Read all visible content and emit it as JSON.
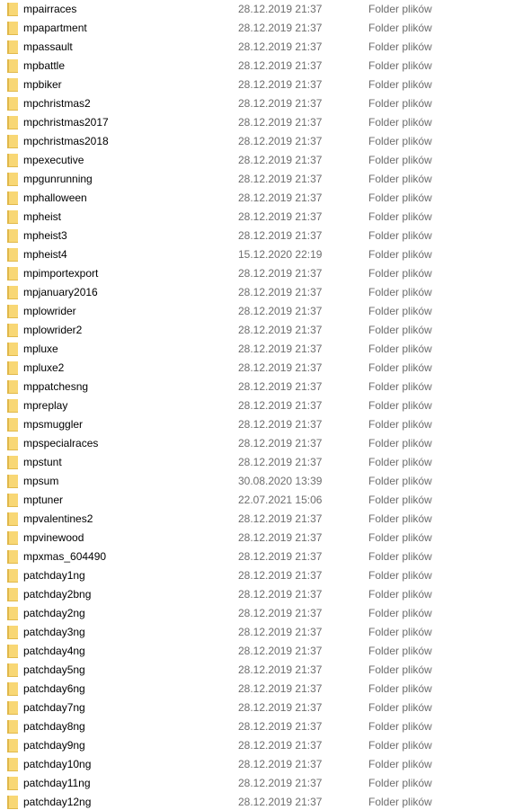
{
  "icon": "folder-icon",
  "colors": {
    "folder_body": "#f8d775",
    "folder_edge": "#e0b84a",
    "secondary_text": "#6d6d6d"
  },
  "rows": [
    {
      "name": "mpairraces",
      "date": "28.12.2019 21:37",
      "type": "Folder plików"
    },
    {
      "name": "mpapartment",
      "date": "28.12.2019 21:37",
      "type": "Folder plików"
    },
    {
      "name": "mpassault",
      "date": "28.12.2019 21:37",
      "type": "Folder plików"
    },
    {
      "name": "mpbattle",
      "date": "28.12.2019 21:37",
      "type": "Folder plików"
    },
    {
      "name": "mpbiker",
      "date": "28.12.2019 21:37",
      "type": "Folder plików"
    },
    {
      "name": "mpchristmas2",
      "date": "28.12.2019 21:37",
      "type": "Folder plików"
    },
    {
      "name": "mpchristmas2017",
      "date": "28.12.2019 21:37",
      "type": "Folder plików"
    },
    {
      "name": "mpchristmas2018",
      "date": "28.12.2019 21:37",
      "type": "Folder plików"
    },
    {
      "name": "mpexecutive",
      "date": "28.12.2019 21:37",
      "type": "Folder plików"
    },
    {
      "name": "mpgunrunning",
      "date": "28.12.2019 21:37",
      "type": "Folder plików"
    },
    {
      "name": "mphalloween",
      "date": "28.12.2019 21:37",
      "type": "Folder plików"
    },
    {
      "name": "mpheist",
      "date": "28.12.2019 21:37",
      "type": "Folder plików"
    },
    {
      "name": "mpheist3",
      "date": "28.12.2019 21:37",
      "type": "Folder plików"
    },
    {
      "name": "mpheist4",
      "date": "15.12.2020 22:19",
      "type": "Folder plików"
    },
    {
      "name": "mpimportexport",
      "date": "28.12.2019 21:37",
      "type": "Folder plików"
    },
    {
      "name": "mpjanuary2016",
      "date": "28.12.2019 21:37",
      "type": "Folder plików"
    },
    {
      "name": "mplowrider",
      "date": "28.12.2019 21:37",
      "type": "Folder plików"
    },
    {
      "name": "mplowrider2",
      "date": "28.12.2019 21:37",
      "type": "Folder plików"
    },
    {
      "name": "mpluxe",
      "date": "28.12.2019 21:37",
      "type": "Folder plików"
    },
    {
      "name": "mpluxe2",
      "date": "28.12.2019 21:37",
      "type": "Folder plików"
    },
    {
      "name": "mppatchesng",
      "date": "28.12.2019 21:37",
      "type": "Folder plików"
    },
    {
      "name": "mpreplay",
      "date": "28.12.2019 21:37",
      "type": "Folder plików"
    },
    {
      "name": "mpsmuggler",
      "date": "28.12.2019 21:37",
      "type": "Folder plików"
    },
    {
      "name": "mpspecialraces",
      "date": "28.12.2019 21:37",
      "type": "Folder plików"
    },
    {
      "name": "mpstunt",
      "date": "28.12.2019 21:37",
      "type": "Folder plików"
    },
    {
      "name": "mpsum",
      "date": "30.08.2020 13:39",
      "type": "Folder plików"
    },
    {
      "name": "mptuner",
      "date": "22.07.2021 15:06",
      "type": "Folder plików"
    },
    {
      "name": "mpvalentines2",
      "date": "28.12.2019 21:37",
      "type": "Folder plików"
    },
    {
      "name": "mpvinewood",
      "date": "28.12.2019 21:37",
      "type": "Folder plików"
    },
    {
      "name": "mpxmas_604490",
      "date": "28.12.2019 21:37",
      "type": "Folder plików"
    },
    {
      "name": "patchday1ng",
      "date": "28.12.2019 21:37",
      "type": "Folder plików"
    },
    {
      "name": "patchday2bng",
      "date": "28.12.2019 21:37",
      "type": "Folder plików"
    },
    {
      "name": "patchday2ng",
      "date": "28.12.2019 21:37",
      "type": "Folder plików"
    },
    {
      "name": "patchday3ng",
      "date": "28.12.2019 21:37",
      "type": "Folder plików"
    },
    {
      "name": "patchday4ng",
      "date": "28.12.2019 21:37",
      "type": "Folder plików"
    },
    {
      "name": "patchday5ng",
      "date": "28.12.2019 21:37",
      "type": "Folder plików"
    },
    {
      "name": "patchday6ng",
      "date": "28.12.2019 21:37",
      "type": "Folder plików"
    },
    {
      "name": "patchday7ng",
      "date": "28.12.2019 21:37",
      "type": "Folder plików"
    },
    {
      "name": "patchday8ng",
      "date": "28.12.2019 21:37",
      "type": "Folder plików"
    },
    {
      "name": "patchday9ng",
      "date": "28.12.2019 21:37",
      "type": "Folder plików"
    },
    {
      "name": "patchday10ng",
      "date": "28.12.2019 21:37",
      "type": "Folder plików"
    },
    {
      "name": "patchday11ng",
      "date": "28.12.2019 21:37",
      "type": "Folder plików"
    },
    {
      "name": "patchday12ng",
      "date": "28.12.2019 21:37",
      "type": "Folder plików"
    }
  ]
}
